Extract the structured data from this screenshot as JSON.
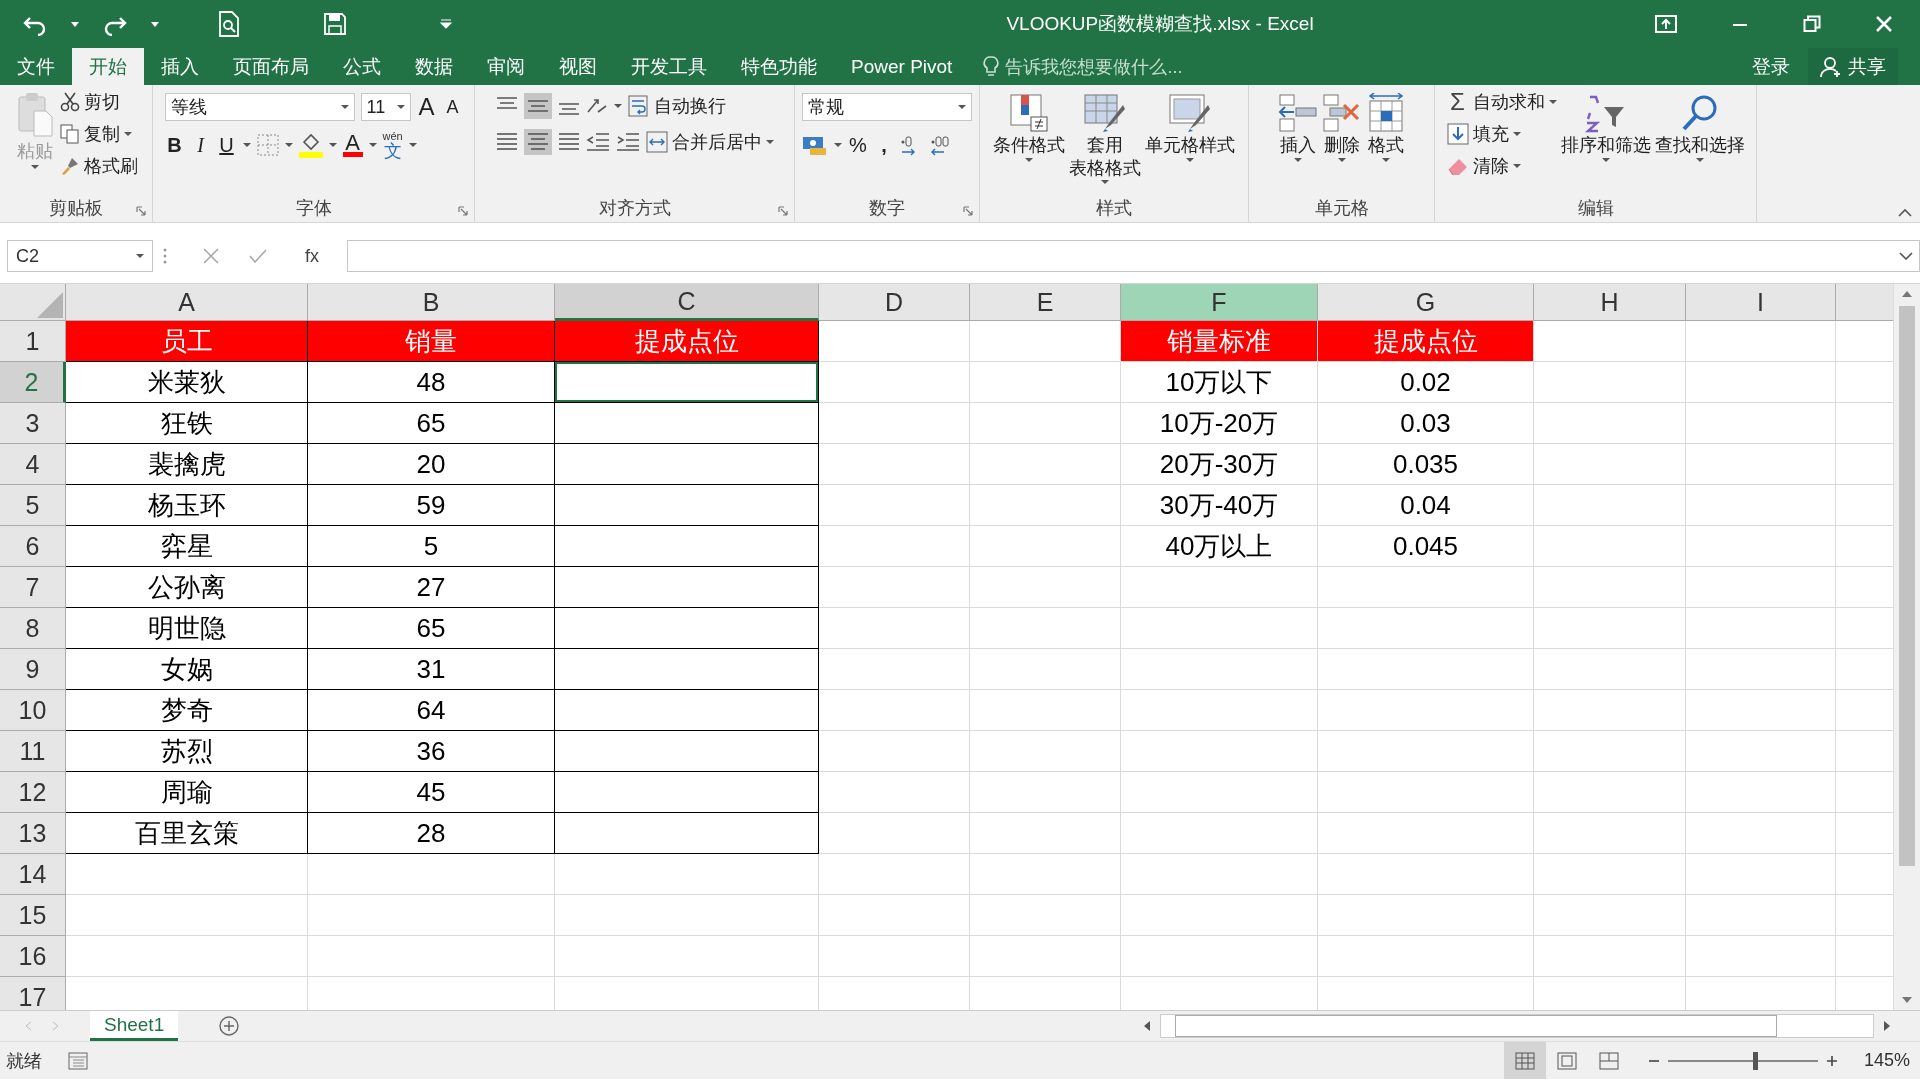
{
  "window": {
    "title": "VLOOKUP函数模糊查找.xlsx - Excel"
  },
  "menu_tabs": [
    {
      "label": "文件",
      "selected": false
    },
    {
      "label": "开始",
      "selected": true
    },
    {
      "label": "插入",
      "selected": false
    },
    {
      "label": "页面布局",
      "selected": false
    },
    {
      "label": "公式",
      "selected": false
    },
    {
      "label": "数据",
      "selected": false
    },
    {
      "label": "审阅",
      "selected": false
    },
    {
      "label": "视图",
      "selected": false
    },
    {
      "label": "开发工具",
      "selected": false
    },
    {
      "label": "特色功能",
      "selected": false
    },
    {
      "label": "Power Pivot",
      "selected": false
    }
  ],
  "tell_me": {
    "placeholder": "告诉我您想要做什么..."
  },
  "account": {
    "sign_in": "登录",
    "share": "共享"
  },
  "ribbon": {
    "clipboard": {
      "title": "剪贴板",
      "paste": {
        "label": "粘贴",
        "disabled": true
      },
      "commands": [
        "剪切",
        "复制",
        "格式刷"
      ]
    },
    "font": {
      "title": "字体",
      "name": "等线",
      "size": "11",
      "grow": "A",
      "shrink": "A",
      "bold": "B",
      "italic": "I",
      "underline": "U",
      "font_color": "A",
      "phonetic": [
        "wén",
        "文"
      ]
    },
    "alignment": {
      "title": "对齐方式",
      "wrap": "自动换行",
      "merge": "合并后居中"
    },
    "number": {
      "title": "数字",
      "format": "常规",
      "percent": "%",
      "comma": ","
    },
    "styles": {
      "title": "样式",
      "buttons": [
        [
          "条件格式"
        ],
        [
          "套用",
          "表格格式"
        ],
        [
          "单元格样式"
        ]
      ]
    },
    "cells": {
      "title": "单元格",
      "buttons": [
        "插入",
        "删除",
        "格式"
      ]
    },
    "editing": {
      "title": "编辑",
      "commands": [
        {
          "symbol": "Σ",
          "label": "自动求和"
        },
        {
          "label": "填充"
        },
        {
          "label": "清除"
        }
      ],
      "buttons": [
        "排序和筛选",
        "查找和选择"
      ]
    }
  },
  "formula_bar": {
    "name_box": "C2",
    "function_symbol": "fx"
  },
  "sheet": {
    "columns": [
      {
        "label": "A",
        "selected": false,
        "highlighted": false
      },
      {
        "label": "B",
        "selected": false,
        "highlighted": false
      },
      {
        "label": "C",
        "selected": true,
        "highlighted": false
      },
      {
        "label": "D",
        "selected": false,
        "highlighted": false
      },
      {
        "label": "E",
        "selected": false,
        "highlighted": false
      },
      {
        "label": "F",
        "selected": false,
        "highlighted": true
      },
      {
        "label": "G",
        "selected": false,
        "highlighted": false
      },
      {
        "label": "H",
        "selected": false,
        "highlighted": false
      },
      {
        "label": "I",
        "selected": false,
        "highlighted": false
      }
    ],
    "rows": [
      {
        "label": "1",
        "selected": false
      },
      {
        "label": "2",
        "selected": true
      },
      {
        "label": "3",
        "selected": false
      },
      {
        "label": "4",
        "selected": false
      },
      {
        "label": "5",
        "selected": false
      },
      {
        "label": "6",
        "selected": false
      },
      {
        "label": "7",
        "selected": false
      },
      {
        "label": "8",
        "selected": false
      },
      {
        "label": "9",
        "selected": false
      },
      {
        "label": "10",
        "selected": false
      },
      {
        "label": "11",
        "selected": false
      },
      {
        "label": "12",
        "selected": false
      },
      {
        "label": "13",
        "selected": false
      },
      {
        "label": "14",
        "selected": false
      },
      {
        "label": "15",
        "selected": false
      },
      {
        "label": "16",
        "selected": false
      },
      {
        "label": "17",
        "selected": false
      }
    ]
  },
  "sales_table": {
    "header": [
      "员工",
      "销量",
      "提成点位"
    ],
    "rows": [
      [
        "米莱狄",
        "48"
      ],
      [
        "狂铁",
        "65"
      ],
      [
        "裴擒虎",
        "20"
      ],
      [
        "杨玉环",
        "59"
      ],
      [
        "弈星",
        "5"
      ],
      [
        "公孙离",
        "27"
      ],
      [
        "明世隐",
        "65"
      ],
      [
        "女娲",
        "31"
      ],
      [
        "梦奇",
        "64"
      ],
      [
        "苏烈",
        "36"
      ],
      [
        "周瑜",
        "45"
      ],
      [
        "百里玄策",
        "28"
      ]
    ]
  },
  "standard_table": {
    "header": [
      "销量标准",
      "提成点位"
    ],
    "rows": [
      [
        "10万以下",
        "0.02"
      ],
      [
        "10万-20万",
        "0.03"
      ],
      [
        "20万-30万",
        "0.035"
      ],
      [
        "30万-40万",
        "0.04"
      ],
      [
        "40万以上",
        "0.045"
      ]
    ]
  },
  "sheet_tabs": [
    {
      "label": "Sheet1",
      "selected": true
    }
  ],
  "status_bar": {
    "status": "就绪",
    "views": [
      {
        "kind": "normal",
        "selected": true
      },
      {
        "kind": "page_layout",
        "selected": false
      },
      {
        "kind": "page_break",
        "selected": false
      }
    ],
    "zoom": {
      "level": 0.58,
      "label": "145%"
    }
  }
}
